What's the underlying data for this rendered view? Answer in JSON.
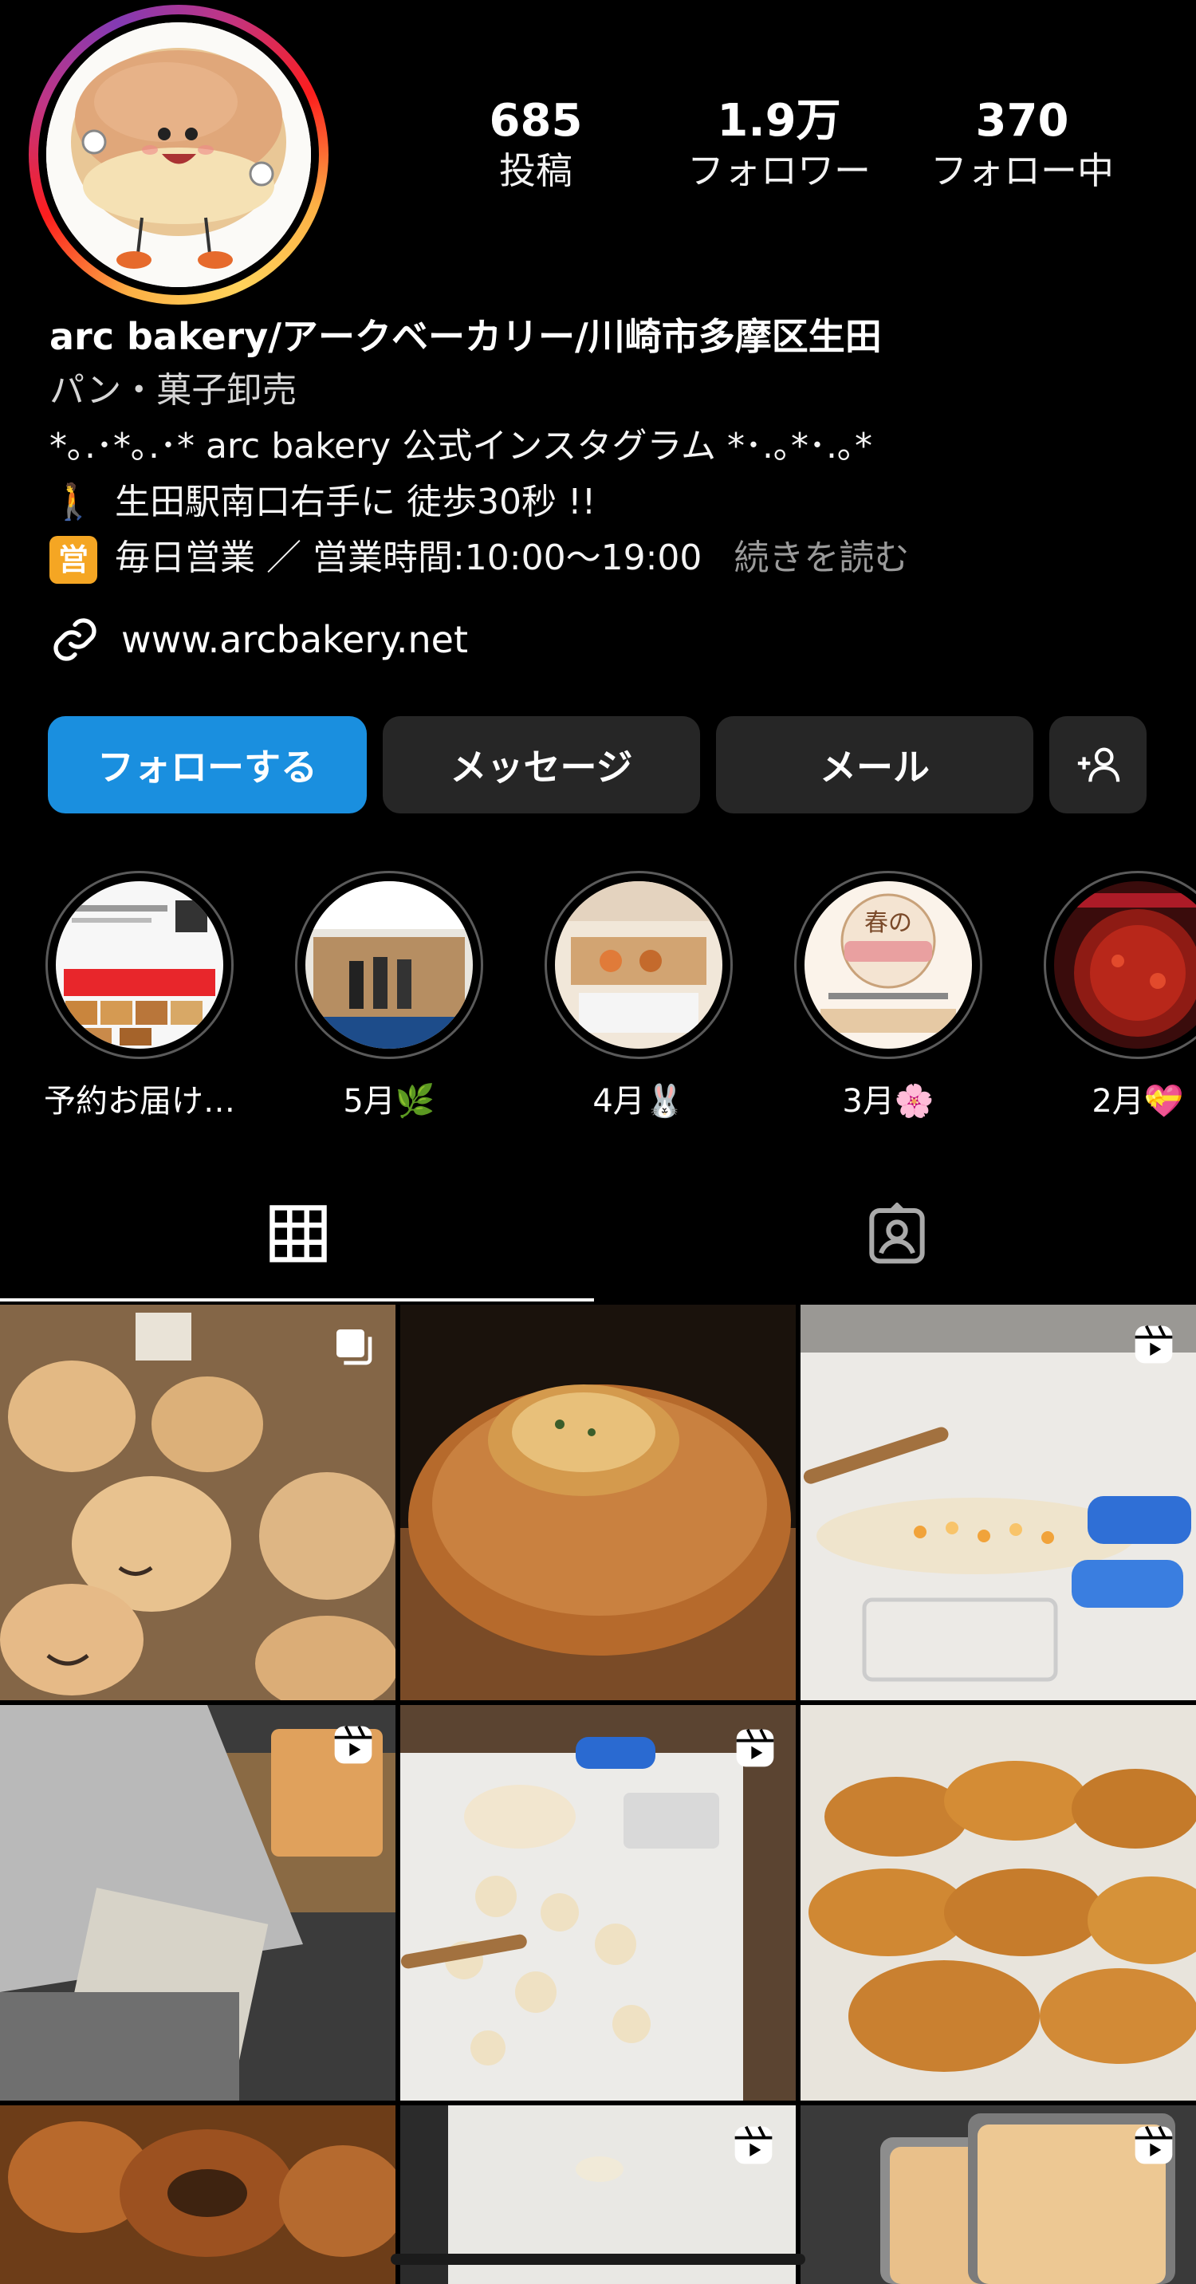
{
  "profile": {
    "stats": [
      {
        "num": "685",
        "label": "投稿"
      },
      {
        "num": "1.9万",
        "label": "フォロワー"
      },
      {
        "num": "370",
        "label": "フォロー中"
      }
    ],
    "name": "arc bakery/アークベーカリー/川崎市多摩区生田",
    "category": "パン・菓子卸売",
    "bio": [
      "*｡.･*｡.･* arc bakery 公式インスタグラム *･.｡*･.｡*",
      "生田駅南口右手に 徒歩30秒 !!",
      "毎日営業 ／ 営業時間:10:00〜19:00"
    ],
    "bio_badge": "営",
    "walker_emoji": "🚶",
    "more_label": "続きを読む",
    "website": "www.arcbakery.net"
  },
  "buttons": {
    "follow": "フォローする",
    "message": "メッセージ",
    "email": "メール"
  },
  "highlights": [
    {
      "label": "予約お届け…"
    },
    {
      "label": "5月🌿"
    },
    {
      "label": "4月🐰"
    },
    {
      "label": "3月🌸"
    },
    {
      "label": "2月💝"
    }
  ],
  "colors": {
    "follow_button": "#1a8fdf",
    "button_bg": "#262626",
    "background": "#000000"
  },
  "tabs": [
    {
      "icon": "grid-icon",
      "active": true
    },
    {
      "icon": "tagged-icon",
      "active": false
    }
  ]
}
